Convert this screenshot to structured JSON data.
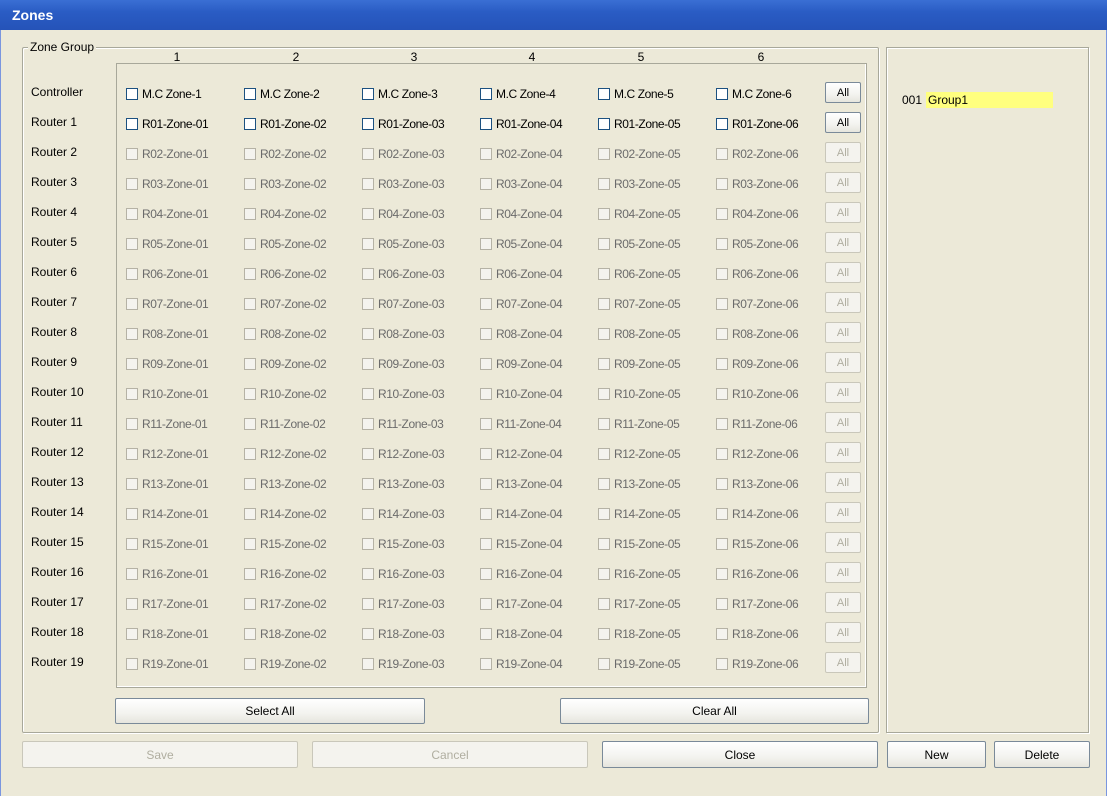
{
  "window": {
    "title": "Zones"
  },
  "zone_group": {
    "caption": "Zone Group",
    "columns": [
      "1",
      "2",
      "3",
      "4",
      "5",
      "6"
    ],
    "all_label": "All",
    "rows": [
      {
        "label": "Controller",
        "zones": [
          "M.C Zone-1",
          "M.C Zone-2",
          "M.C Zone-3",
          "M.C Zone-4",
          "M.C Zone-5",
          "M.C Zone-6"
        ],
        "enabled": true
      },
      {
        "label": "Router 1",
        "zones": [
          "R01-Zone-01",
          "R01-Zone-02",
          "R01-Zone-03",
          "R01-Zone-04",
          "R01-Zone-05",
          "R01-Zone-06"
        ],
        "enabled": true
      },
      {
        "label": "Router 2",
        "zones": [
          "R02-Zone-01",
          "R02-Zone-02",
          "R02-Zone-03",
          "R02-Zone-04",
          "R02-Zone-05",
          "R02-Zone-06"
        ],
        "enabled": false
      },
      {
        "label": "Router 3",
        "zones": [
          "R03-Zone-01",
          "R03-Zone-02",
          "R03-Zone-03",
          "R03-Zone-04",
          "R03-Zone-05",
          "R03-Zone-06"
        ],
        "enabled": false
      },
      {
        "label": "Router 4",
        "zones": [
          "R04-Zone-01",
          "R04-Zone-02",
          "R04-Zone-03",
          "R04-Zone-04",
          "R04-Zone-05",
          "R04-Zone-06"
        ],
        "enabled": false
      },
      {
        "label": "Router 5",
        "zones": [
          "R05-Zone-01",
          "R05-Zone-02",
          "R05-Zone-03",
          "R05-Zone-04",
          "R05-Zone-05",
          "R05-Zone-06"
        ],
        "enabled": false
      },
      {
        "label": "Router 6",
        "zones": [
          "R06-Zone-01",
          "R06-Zone-02",
          "R06-Zone-03",
          "R06-Zone-04",
          "R06-Zone-05",
          "R06-Zone-06"
        ],
        "enabled": false
      },
      {
        "label": "Router 7",
        "zones": [
          "R07-Zone-01",
          "R07-Zone-02",
          "R07-Zone-03",
          "R07-Zone-04",
          "R07-Zone-05",
          "R07-Zone-06"
        ],
        "enabled": false
      },
      {
        "label": "Router 8",
        "zones": [
          "R08-Zone-01",
          "R08-Zone-02",
          "R08-Zone-03",
          "R08-Zone-04",
          "R08-Zone-05",
          "R08-Zone-06"
        ],
        "enabled": false
      },
      {
        "label": "Router 9",
        "zones": [
          "R09-Zone-01",
          "R09-Zone-02",
          "R09-Zone-03",
          "R09-Zone-04",
          "R09-Zone-05",
          "R09-Zone-06"
        ],
        "enabled": false
      },
      {
        "label": "Router 10",
        "zones": [
          "R10-Zone-01",
          "R10-Zone-02",
          "R10-Zone-03",
          "R10-Zone-04",
          "R10-Zone-05",
          "R10-Zone-06"
        ],
        "enabled": false
      },
      {
        "label": "Router 11",
        "zones": [
          "R11-Zone-01",
          "R11-Zone-02",
          "R11-Zone-03",
          "R11-Zone-04",
          "R11-Zone-05",
          "R11-Zone-06"
        ],
        "enabled": false
      },
      {
        "label": "Router 12",
        "zones": [
          "R12-Zone-01",
          "R12-Zone-02",
          "R12-Zone-03",
          "R12-Zone-04",
          "R12-Zone-05",
          "R12-Zone-06"
        ],
        "enabled": false
      },
      {
        "label": "Router 13",
        "zones": [
          "R13-Zone-01",
          "R13-Zone-02",
          "R13-Zone-03",
          "R13-Zone-04",
          "R13-Zone-05",
          "R13-Zone-06"
        ],
        "enabled": false
      },
      {
        "label": "Router 14",
        "zones": [
          "R14-Zone-01",
          "R14-Zone-02",
          "R14-Zone-03",
          "R14-Zone-04",
          "R14-Zone-05",
          "R14-Zone-06"
        ],
        "enabled": false
      },
      {
        "label": "Router 15",
        "zones": [
          "R15-Zone-01",
          "R15-Zone-02",
          "R15-Zone-03",
          "R15-Zone-04",
          "R15-Zone-05",
          "R15-Zone-06"
        ],
        "enabled": false
      },
      {
        "label": "Router 16",
        "zones": [
          "R16-Zone-01",
          "R16-Zone-02",
          "R16-Zone-03",
          "R16-Zone-04",
          "R16-Zone-05",
          "R16-Zone-06"
        ],
        "enabled": false
      },
      {
        "label": "Router 17",
        "zones": [
          "R17-Zone-01",
          "R17-Zone-02",
          "R17-Zone-03",
          "R17-Zone-04",
          "R17-Zone-05",
          "R17-Zone-06"
        ],
        "enabled": false
      },
      {
        "label": "Router 18",
        "zones": [
          "R18-Zone-01",
          "R18-Zone-02",
          "R18-Zone-03",
          "R18-Zone-04",
          "R18-Zone-05",
          "R18-Zone-06"
        ],
        "enabled": false
      },
      {
        "label": "Router 19",
        "zones": [
          "R19-Zone-01",
          "R19-Zone-02",
          "R19-Zone-03",
          "R19-Zone-04",
          "R19-Zone-05",
          "R19-Zone-06"
        ],
        "enabled": false
      }
    ],
    "select_all_label": "Select All",
    "clear_all_label": "Clear All"
  },
  "groups": [
    {
      "number": "001",
      "name": "Group1",
      "highlight_color": "#ffff7f"
    }
  ],
  "footer": {
    "save_label": "Save",
    "cancel_label": "Cancel",
    "close_label": "Close",
    "new_label": "New",
    "delete_label": "Delete"
  },
  "colors": {
    "titlebar": "#2a5cc4",
    "window_bg": "#ece9d8",
    "checkbox_border": "#1c5180"
  }
}
